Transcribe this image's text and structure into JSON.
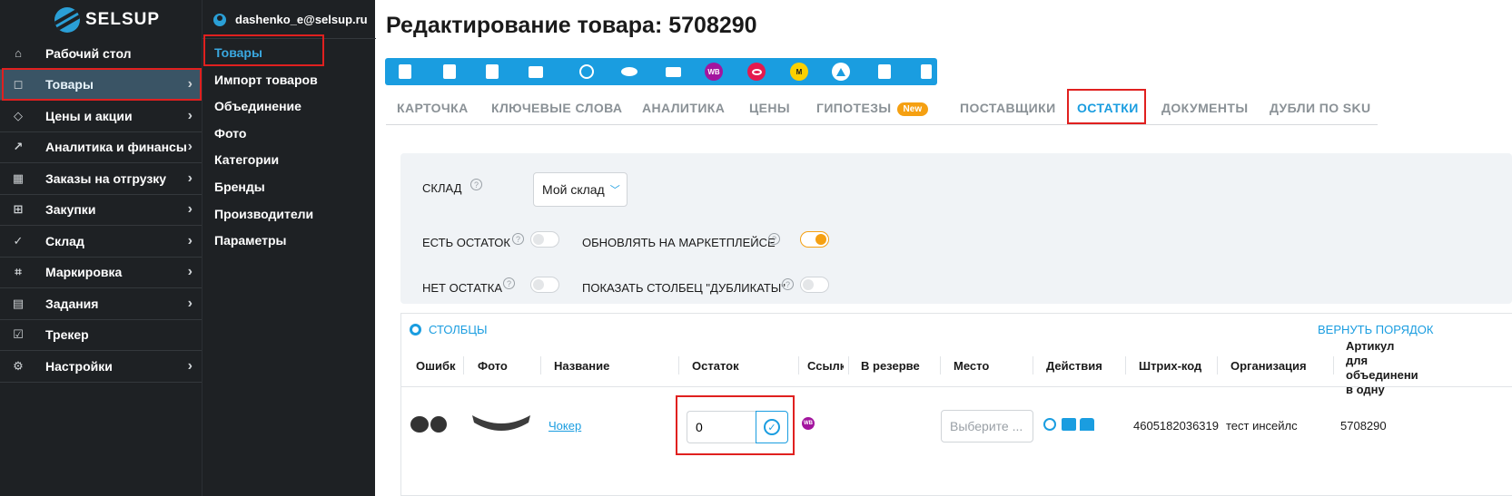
{
  "brand": {
    "name": "SELSUP"
  },
  "sidebar": {
    "items": [
      {
        "label": "Рабочий стол",
        "icon": "home-icon",
        "glyph": "⌂",
        "chevron": false
      },
      {
        "label": "Товары",
        "icon": "bag-icon",
        "glyph": "◻",
        "chevron": true,
        "active": true
      },
      {
        "label": "Цены и акции",
        "icon": "price-tag-icon",
        "glyph": "◇",
        "chevron": true
      },
      {
        "label": "Аналитика и финансы",
        "icon": "chart-icon",
        "glyph": "↗",
        "chevron": true
      },
      {
        "label": "Заказы на отгрузку",
        "icon": "store-icon",
        "glyph": "▦",
        "chevron": true
      },
      {
        "label": "Закупки",
        "icon": "cart-icon",
        "glyph": "⊞",
        "chevron": true
      },
      {
        "label": "Склад",
        "icon": "check-circle-icon",
        "glyph": "✓",
        "chevron": true
      },
      {
        "label": "Маркировка",
        "icon": "scan-icon",
        "glyph": "⌗",
        "chevron": true
      },
      {
        "label": "Задания",
        "icon": "calendar-icon",
        "glyph": "▤",
        "chevron": true
      },
      {
        "label": "Трекер",
        "icon": "tracker-icon",
        "glyph": "☑",
        "chevron": false
      },
      {
        "label": "Настройки",
        "icon": "gear-icon",
        "glyph": "⚙",
        "chevron": true
      }
    ]
  },
  "subnav": {
    "user": "dashenko_e@selsup.ru",
    "items": [
      "Товары",
      "Импорт товаров",
      "Объединение",
      "Фото",
      "Категории",
      "Бренды",
      "Производители",
      "Параметры"
    ]
  },
  "main": {
    "title": "Редактирование товара: 5708290",
    "toolbar": {
      "color": "#1a9de0",
      "market_badges": [
        "WB",
        "",
        "M",
        ""
      ]
    },
    "tabs": [
      {
        "label": "КАРТОЧКА"
      },
      {
        "label": "КЛЮЧЕВЫЕ СЛОВА"
      },
      {
        "label": "АНАЛИТИКА"
      },
      {
        "label": "ЦЕНЫ"
      },
      {
        "label": "ГИПОТЕЗЫ",
        "badge": "New"
      },
      {
        "label": "ПОСТАВЩИКИ"
      },
      {
        "label": "ОСТАТКИ",
        "active": true
      },
      {
        "label": "ДОКУМЕНТЫ"
      },
      {
        "label": "ДУБЛИ ПО SKU"
      }
    ],
    "filters": {
      "warehouse_label": "СКЛАД",
      "warehouse_value": "Мой склад",
      "has_stock_label": "ЕСТЬ ОСТАТОК",
      "has_stock_on": false,
      "update_marketplace_label": "ОБНОВЛЯТЬ НА МАРКЕТПЛЕЙСЕ",
      "update_marketplace_on": true,
      "no_stock_label": "НЕТ ОСТАТКА",
      "no_stock_on": false,
      "show_duplicates_label": "ПОКАЗАТЬ СТОЛБЕЦ \"ДУБЛИКАТЫ\"",
      "show_duplicates_on": false
    },
    "table": {
      "columns_button": "СТОЛБЦЫ",
      "reset_order_button": "ВЕРНУТЬ ПОРЯДОК",
      "headers": [
        "Ошибка",
        "Фото",
        "Название",
        "Остаток",
        "Ссылки",
        "В резерве",
        "Место",
        "Действия",
        "Штрих-код",
        "Организация",
        "Артикул для объединения в одну"
      ],
      "row": {
        "name": "Чокер",
        "stock": "0",
        "place_placeholder": "Выберите ...",
        "barcode": "4605182036319",
        "organization": "тест инсейлс",
        "article": "5708290",
        "link_badge": "WB"
      }
    }
  },
  "colors": {
    "accent": "#1a9de0",
    "highlight": "#e0201f",
    "toggle_on": "#f5a012"
  }
}
